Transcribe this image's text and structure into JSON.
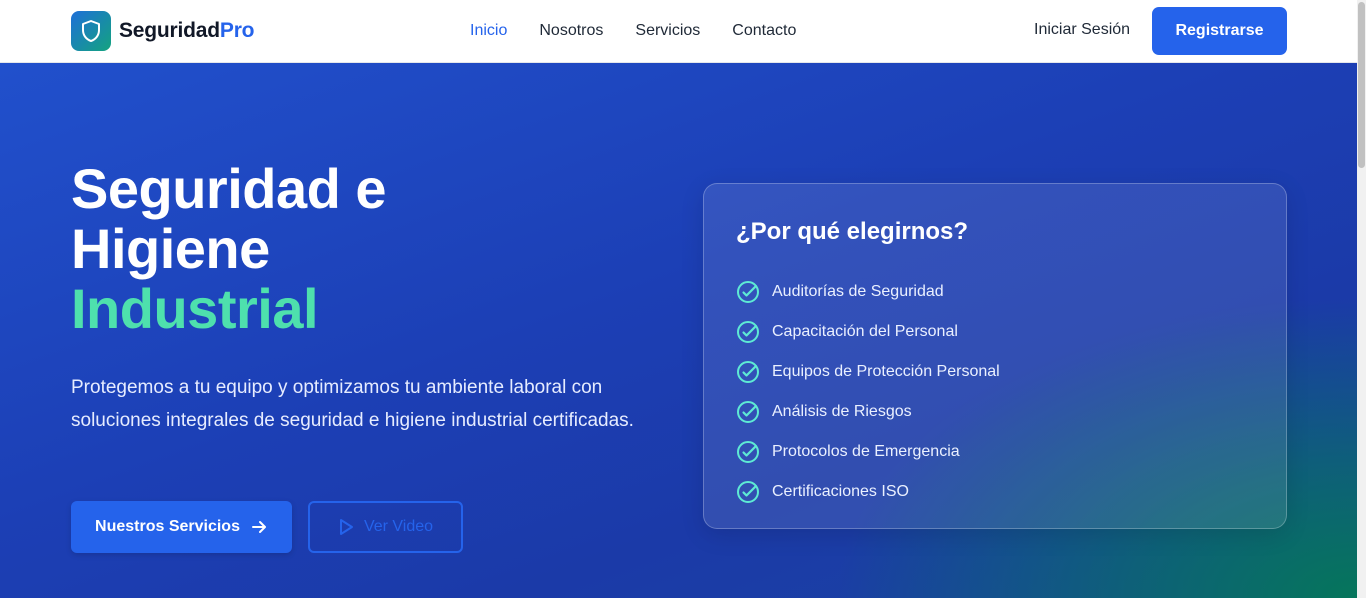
{
  "brand": {
    "name_part1": "Seguridad",
    "name_part2": "Pro",
    "logo_icon": "shield-icon"
  },
  "nav": {
    "links": [
      {
        "label": "Inicio",
        "active": true
      },
      {
        "label": "Nosotros",
        "active": false
      },
      {
        "label": "Servicios",
        "active": false
      },
      {
        "label": "Contacto",
        "active": false
      }
    ],
    "login_label": "Iniciar Sesión",
    "register_label": "Registrarse"
  },
  "hero": {
    "title_line1": "Seguridad e",
    "title_line2": "Higiene",
    "title_accent": "Industrial",
    "description": "Protegemos a tu equipo y optimizamos tu ambiente laboral con soluciones integrales de seguridad e higiene industrial certificadas.",
    "primary_button": "Nuestros Servicios",
    "secondary_button": "Ver Video"
  },
  "card": {
    "title": "¿Por qué elegirnos?",
    "items": [
      "Auditorías de Seguridad",
      "Capacitación del Personal",
      "Equipos de Protección Personal",
      "Análisis de Riesgos",
      "Protocolos de Emergencia",
      "Certificaciones ISO"
    ]
  },
  "colors": {
    "primary": "#2563eb",
    "accent_green": "#4ee0ad",
    "check_green": "#5eead4",
    "dark_text": "#111827"
  }
}
